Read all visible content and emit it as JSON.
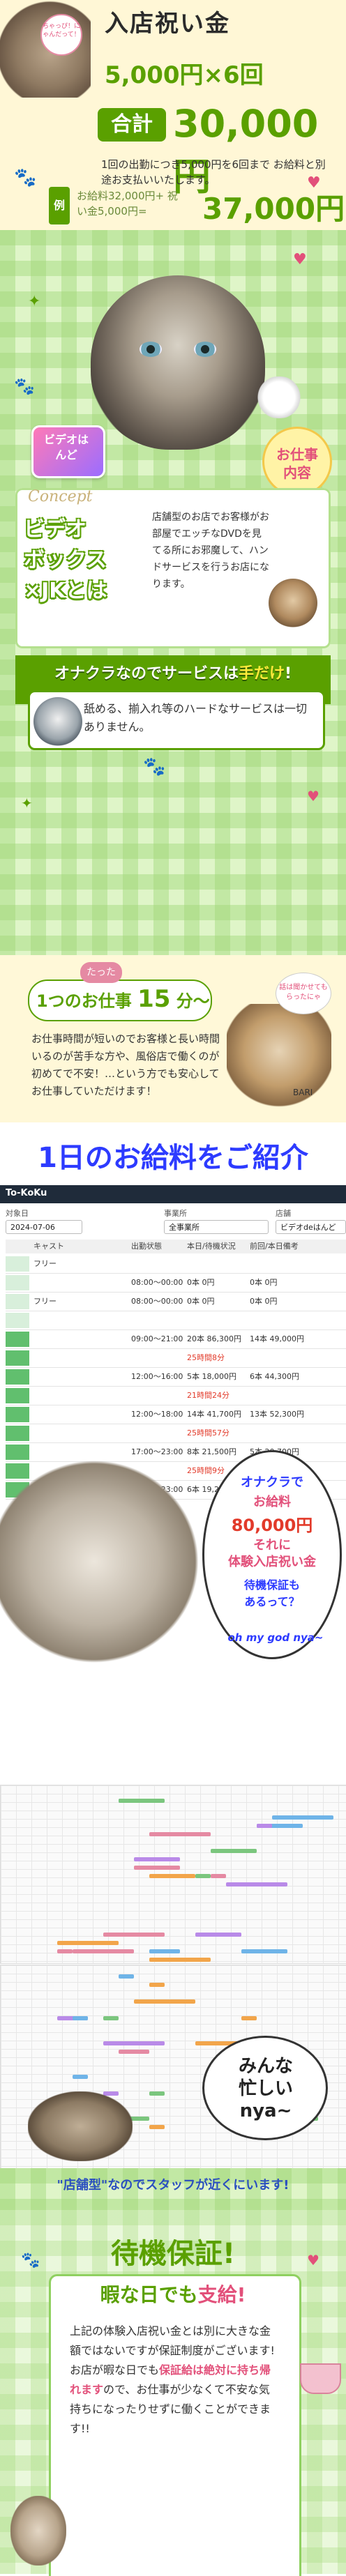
{
  "bonus": {
    "cat_bubble": "ちゃっぴ！にゃんだって！",
    "title": "入店祝い金",
    "line1": "5,000円×6回",
    "total_label": "合計",
    "total_value": "30,000円",
    "desc": "1回の出勤につき5,000円を6回まで お給料と別途お支払いいたします。",
    "example_label": "例",
    "example_text": "お給料32,000円+ 祝い金5,000円=",
    "example_total": "37,000円"
  },
  "concept": {
    "logo_text": "ビデオはんど",
    "work_badge_l1": "お仕事",
    "work_badge_l2": "内容",
    "label": "Concept",
    "heading_l1": "ビデオ",
    "heading_l2": "ボックス",
    "heading_l3": "×JKとは",
    "desc": "店舗型のお店でお客様がお部屋でエッチなDVDを見てる所にお邪魔して、ハンドサービスを行うお店になります。",
    "kiss_title_a": "オナクラなので",
    "kiss_title_b": "サービスは",
    "kiss_title_c": "手だけ",
    "kiss_title_d": "!",
    "kiss_text": "舐める、揃入れ等のハードなサービスは一切ありません。"
  },
  "short": {
    "tatta": "たった",
    "prefix": "1つのお仕事",
    "num": "15",
    "suffix": "分〜",
    "bubble": "話は聞かせてもらったにゃ",
    "cat_label": "BARI",
    "desc": "お仕事時間が短いのでお客様と長い時間いるのが苦手な方や、風俗店で働くのが初めてで不安！…という方でも安心してお仕事していただけます！"
  },
  "salary": {
    "title": "1日のお給料をご紹介"
  },
  "app": {
    "brand": "To-KoKu",
    "filter_date_label": "対象日",
    "filter_date": "2024-07-06",
    "filter_office_label": "事業所",
    "filter_office": "全事業所",
    "filter_store_label": "店舗",
    "filter_store": "ビデオdeはんど",
    "columns": [
      "キャスト",
      "出勤状態",
      "本日/待機状況",
      "前回/本日備考"
    ],
    "rows": [
      {
        "cast": "フリー",
        "status": "",
        "today": "",
        "prev": ""
      },
      {
        "cast": "",
        "status": "08:00〜00:00",
        "today": "0本 0円",
        "prev": "0本 0円"
      },
      {
        "cast": "フリー",
        "status": "08:00〜00:00",
        "today": "0本 0円",
        "prev": "0本 0円"
      },
      {
        "cast": "",
        "status": "",
        "today": "",
        "prev": ""
      },
      {
        "cast": "",
        "status": "09:00〜21:00",
        "today": "20本 86,300円",
        "prev": "14本 49,000円"
      },
      {
        "cast": "",
        "status": "",
        "today": "25時間8分",
        "prev": ""
      },
      {
        "cast": "",
        "status": "12:00〜16:00",
        "today": "5本 18,000円",
        "prev": "6本 44,300円"
      },
      {
        "cast": "",
        "status": "",
        "today": "21時間24分",
        "prev": ""
      },
      {
        "cast": "",
        "status": "12:00〜18:00",
        "today": "14本 41,700円",
        "prev": "13本 52,300円"
      },
      {
        "cast": "",
        "status": "",
        "today": "25時間57分",
        "prev": ""
      },
      {
        "cast": "",
        "status": "17:00〜23:00",
        "today": "8本 21,500円",
        "prev": "5本 20,700円"
      },
      {
        "cast": "",
        "status": "",
        "today": "25時間9分",
        "prev": ""
      },
      {
        "cast": "",
        "status": "17:00〜23:00",
        "today": "6本 19,200円",
        "prev": "0本 0円"
      }
    ],
    "bubble_l1": "オナクラで",
    "bubble_l2": "お給料",
    "bubble_l3": "80,000円",
    "bubble_l4": "それに",
    "bubble_l5": "体験入店祝い金",
    "bubble_l6": "待機保証も",
    "bubble_l7": "あるって？",
    "bubble_l8": "oh my god nya~"
  },
  "busy": {
    "text_l1": "みんな",
    "text_l2": "忙しい",
    "text_l3": "nya~"
  },
  "staff": {
    "text": "\"店舗型\"なのでスタッフが近くにいます!"
  },
  "guarantee": {
    "title": "待機保証!",
    "sub_a": "暇な日でも",
    "sub_b": "支給!",
    "desc_a": "上記の体験入店祝い金とは別に大きな金額ではないですが保証制度がございます! お店が暇な日でも",
    "desc_hl": "保証給は絶対に持ち帰れます",
    "desc_b": "ので、お仕事が少なくて不安な気持ちになったりせずに働くことができます!!"
  }
}
